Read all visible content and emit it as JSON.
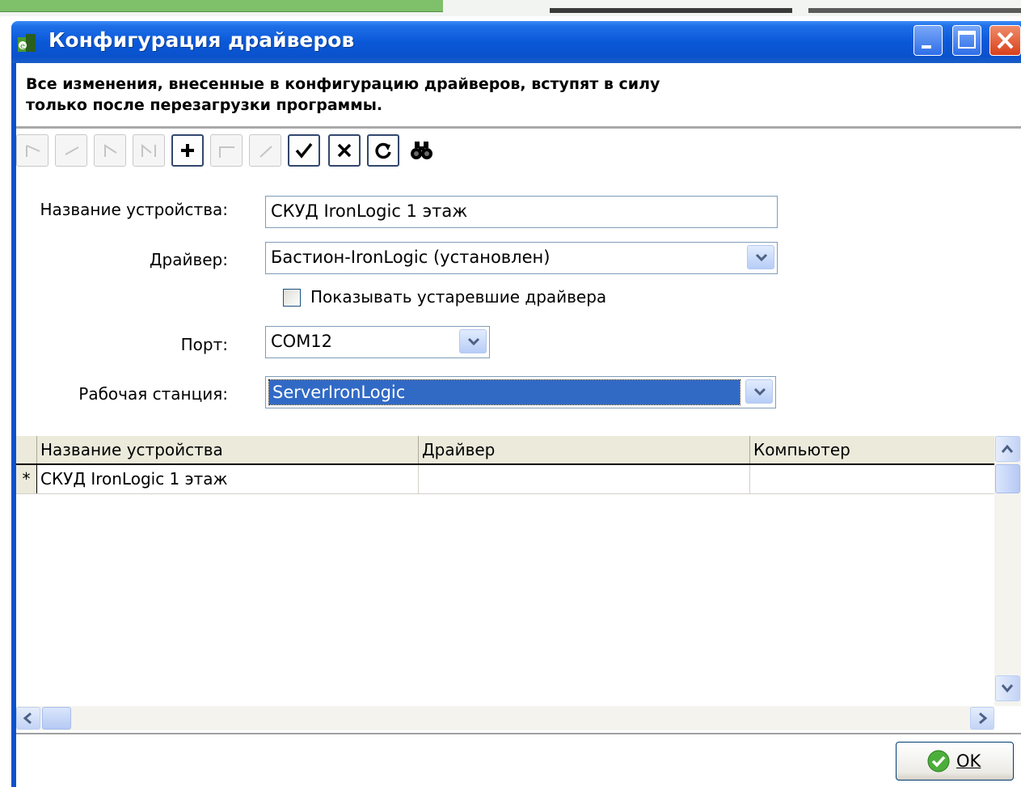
{
  "window": {
    "title": "Конфигурация драйверов",
    "icons": {
      "app": "app-icon",
      "minimize": "minimize-icon",
      "maximize": "maximize-icon",
      "close": "close-icon"
    }
  },
  "notice": {
    "line1": "Все изменения, внесенные в конфигурацию драйверов, вступят в силу",
    "line2": "только после перезагрузки программы."
  },
  "toolbar": {
    "buttons": [
      {
        "icon": "first-record-icon",
        "enabled": false
      },
      {
        "icon": "prior-record-icon",
        "enabled": false
      },
      {
        "icon": "next-record-icon",
        "enabled": false
      },
      {
        "icon": "last-record-icon",
        "enabled": false
      },
      {
        "icon": "add-icon",
        "enabled": true
      },
      {
        "icon": "delete-icon",
        "enabled": false
      },
      {
        "icon": "edit-icon",
        "enabled": false
      },
      {
        "icon": "apply-icon",
        "enabled": true
      },
      {
        "icon": "cancel-icon",
        "enabled": true
      },
      {
        "icon": "refresh-icon",
        "enabled": true
      },
      {
        "icon": "search-icon",
        "enabled": true
      }
    ]
  },
  "form": {
    "device_name_label": "Название устройства:",
    "device_name_value": "СКУД IronLogic 1 этаж",
    "driver_label": "Драйвер:",
    "driver_value": "Бастион-IronLogic (установлен)",
    "show_outdated_label": "Показывать устаревшие драйвера",
    "show_outdated_checked": false,
    "port_label": "Порт:",
    "port_value": "COM12",
    "station_label": "Рабочая станция:",
    "station_value": "ServerIronLogic"
  },
  "grid": {
    "columns": [
      "Название устройства",
      "Драйвер",
      "Компьютер"
    ],
    "rows": [
      {
        "indicator": "*",
        "cells": [
          "СКУД IronLogic 1 этаж",
          "",
          ""
        ]
      }
    ]
  },
  "footer": {
    "ok_label": "OK"
  },
  "colors": {
    "titlebar": "#0a58d8",
    "selection": "#316ac5",
    "close": "#d8401c"
  }
}
